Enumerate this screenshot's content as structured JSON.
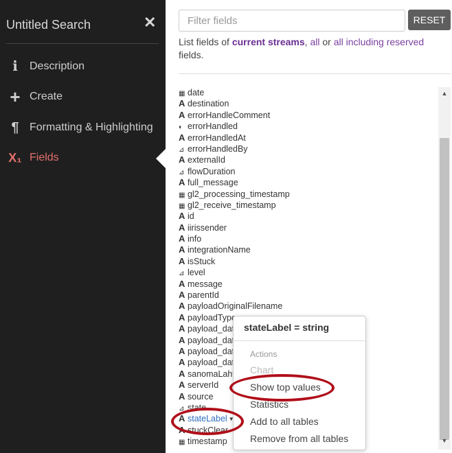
{
  "sidebar": {
    "title": "Untitled Search",
    "close_glyph": "✕",
    "items": [
      {
        "label": "Description",
        "icon": "info-icon",
        "glyph": "ℹ"
      },
      {
        "label": "Create",
        "icon": "plus-icon",
        "glyph": "+"
      },
      {
        "label": "Formatting & Highlighting",
        "icon": "paragraph-icon",
        "glyph": "¶"
      },
      {
        "label": "Fields",
        "icon": "fields-icon",
        "glyph": "X₁",
        "active": true
      }
    ]
  },
  "main": {
    "filter": {
      "placeholder": "Filter fields",
      "value": ""
    },
    "reset_label": "RESET",
    "list_prefix": "List fields of ",
    "link_current": "current streams",
    "sep1": ", ",
    "link_all": "all",
    "sep2": " or ",
    "link_reserved": "all including reserved",
    "list_suffix": " fields."
  },
  "fields": [
    {
      "name": "date",
      "type": "date",
      "glyph": "▦"
    },
    {
      "name": "destination",
      "type": "string",
      "glyph": "A"
    },
    {
      "name": "errorHandleComment",
      "type": "string",
      "glyph": "A"
    },
    {
      "name": "errorHandled",
      "type": "boolean",
      "glyph": "◐"
    },
    {
      "name": "errorHandledAt",
      "type": "string",
      "glyph": "A"
    },
    {
      "name": "errorHandledBy",
      "type": "numeric",
      "glyph": "⊿"
    },
    {
      "name": "externalId",
      "type": "string",
      "glyph": "A"
    },
    {
      "name": "flowDuration",
      "type": "numeric",
      "glyph": "⊿"
    },
    {
      "name": "full_message",
      "type": "string",
      "glyph": "A"
    },
    {
      "name": "gl2_processing_timestamp",
      "type": "date",
      "glyph": "▦"
    },
    {
      "name": "gl2_receive_timestamp",
      "type": "date",
      "glyph": "▦"
    },
    {
      "name": "id",
      "type": "string",
      "glyph": "A"
    },
    {
      "name": "iirissender",
      "type": "string",
      "glyph": "A"
    },
    {
      "name": "info",
      "type": "string",
      "glyph": "A"
    },
    {
      "name": "integrationName",
      "type": "string",
      "glyph": "A"
    },
    {
      "name": "isStuck",
      "type": "string",
      "glyph": "A"
    },
    {
      "name": "level",
      "type": "numeric",
      "glyph": "⊿"
    },
    {
      "name": "message",
      "type": "string",
      "glyph": "A"
    },
    {
      "name": "parentId",
      "type": "string",
      "glyph": "A"
    },
    {
      "name": "payloadOriginalFilename",
      "type": "string",
      "glyph": "A"
    },
    {
      "name": "payloadType",
      "type": "string",
      "glyph": "A"
    },
    {
      "name": "payload_dat",
      "type": "string",
      "glyph": "A"
    },
    {
      "name": "payload_dat",
      "type": "string",
      "glyph": "A"
    },
    {
      "name": "payload_dat",
      "type": "string",
      "glyph": "A"
    },
    {
      "name": "payload_dat",
      "type": "string",
      "glyph": "A"
    },
    {
      "name": "sanomaLaht",
      "type": "string",
      "glyph": "A"
    },
    {
      "name": "serverId",
      "type": "string",
      "glyph": "A"
    },
    {
      "name": "source",
      "type": "string",
      "glyph": "A"
    },
    {
      "name": "state",
      "type": "numeric",
      "glyph": "⊿"
    },
    {
      "name": "stateLabel",
      "type": "string",
      "glyph": "A",
      "active": true
    },
    {
      "name": "stuckClear",
      "type": "string",
      "glyph": "A"
    },
    {
      "name": "timestamp",
      "type": "date",
      "glyph": "▦"
    }
  ],
  "popover": {
    "title": "stateLabel = string",
    "header": "Actions",
    "items": [
      {
        "label": "Chart",
        "disabled": true
      },
      {
        "label": "Show top values"
      },
      {
        "label": "Statistics"
      },
      {
        "label": "Add to all tables"
      },
      {
        "label": "Remove from all tables"
      }
    ]
  },
  "colors": {
    "sidebar_bg": "#1f1f1f",
    "active_nav": "#e3706c",
    "link": "#7a3fa0",
    "active_field": "#2f6dbf",
    "highlight": "#b00f1a"
  }
}
